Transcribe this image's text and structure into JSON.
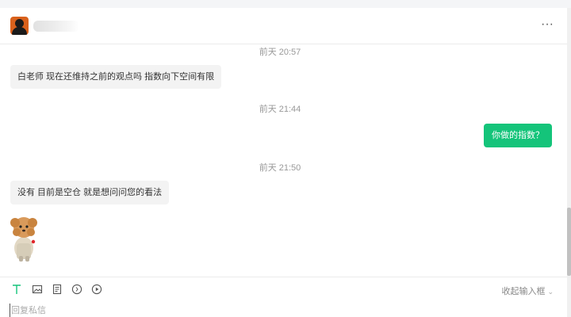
{
  "header": {
    "contact_name": "",
    "more_label": "···"
  },
  "messages": [
    {
      "type": "time",
      "text": "前天 20:57"
    },
    {
      "type": "incoming",
      "text": "白老师 现在还维持之前的观点吗 指数向下空间有限"
    },
    {
      "type": "time",
      "text": "前天 21:44"
    },
    {
      "type": "outgoing",
      "text": "你做的指数？"
    },
    {
      "type": "time",
      "text": "前天 21:50"
    },
    {
      "type": "incoming",
      "text": "没有 目前是空仓 就是想问问您的看法"
    },
    {
      "type": "sticker",
      "icon": "puppy-sticker"
    }
  ],
  "toolbar": {
    "icons": [
      "text-format-icon",
      "image-icon",
      "file-icon",
      "voice-icon",
      "video-icon"
    ],
    "collapse_label": "收起输入框",
    "accent_color": "#14c47a"
  },
  "reply": {
    "placeholder": "回复私信"
  }
}
